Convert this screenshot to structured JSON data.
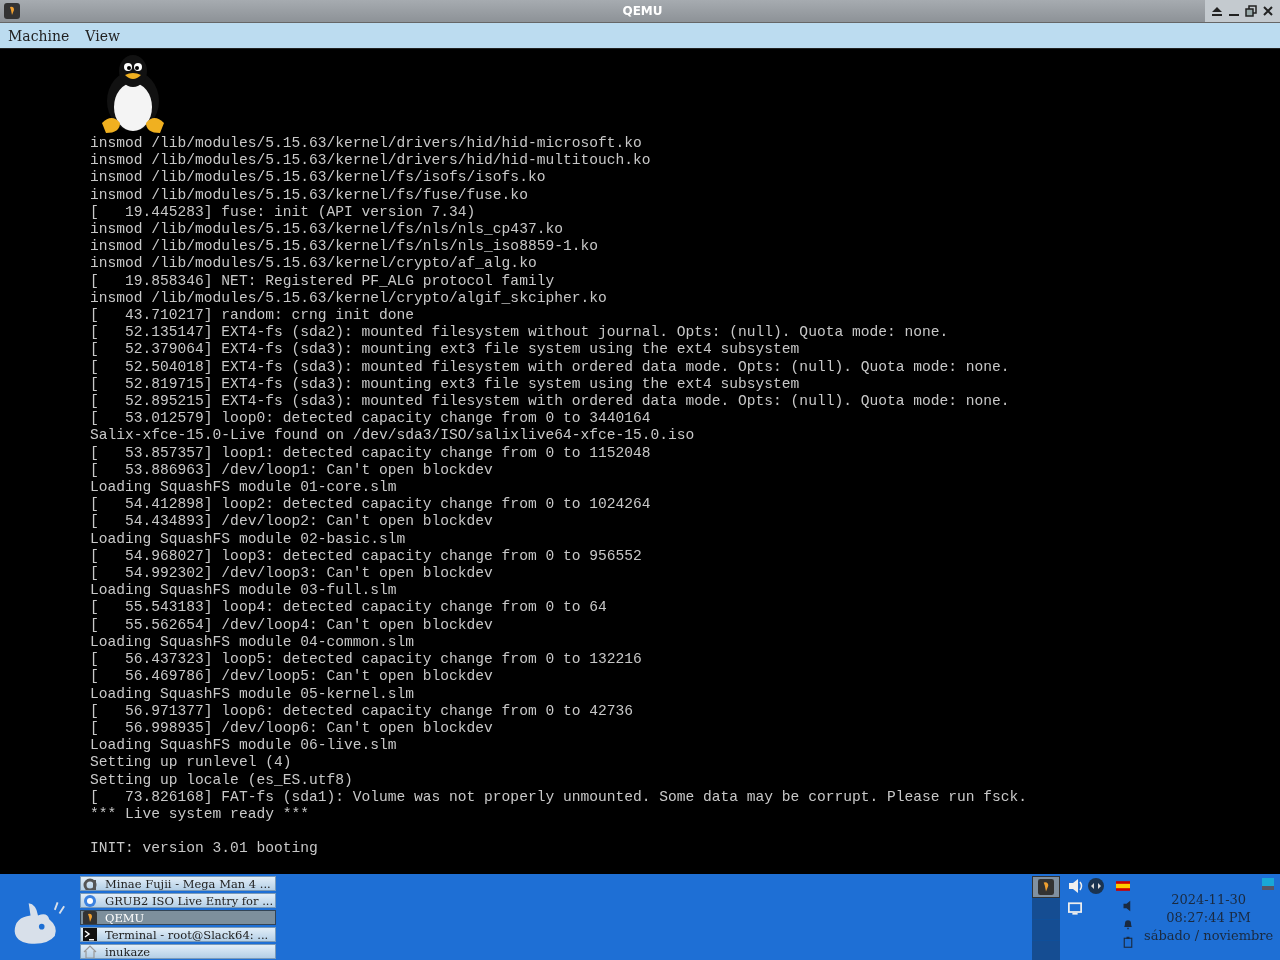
{
  "window": {
    "title": "QEMU"
  },
  "menu": [
    {
      "label": "Machine"
    },
    {
      "label": "View"
    }
  ],
  "console": {
    "lines": [
      "insmod /lib/modules/5.15.63/kernel/drivers/hid/hid-microsoft.ko",
      "insmod /lib/modules/5.15.63/kernel/drivers/hid/hid-multitouch.ko",
      "insmod /lib/modules/5.15.63/kernel/fs/isofs/isofs.ko",
      "insmod /lib/modules/5.15.63/kernel/fs/fuse/fuse.ko",
      "[   19.445283] fuse: init (API version 7.34)",
      "insmod /lib/modules/5.15.63/kernel/fs/nls/nls_cp437.ko",
      "insmod /lib/modules/5.15.63/kernel/fs/nls/nls_iso8859-1.ko",
      "insmod /lib/modules/5.15.63/kernel/crypto/af_alg.ko",
      "[   19.858346] NET: Registered PF_ALG protocol family",
      "insmod /lib/modules/5.15.63/kernel/crypto/algif_skcipher.ko",
      "[   43.710217] random: crng init done",
      "[   52.135147] EXT4-fs (sda2): mounted filesystem without journal. Opts: (null). Quota mode: none.",
      "[   52.379064] EXT4-fs (sda3): mounting ext3 file system using the ext4 subsystem",
      "[   52.504018] EXT4-fs (sda3): mounted filesystem with ordered data mode. Opts: (null). Quota mode: none.",
      "[   52.819715] EXT4-fs (sda3): mounting ext3 file system using the ext4 subsystem",
      "[   52.895215] EXT4-fs (sda3): mounted filesystem with ordered data mode. Opts: (null). Quota mode: none.",
      "[   53.012579] loop0: detected capacity change from 0 to 3440164",
      "Salix-xfce-15.0-Live found on /dev/sda3/ISO/salixlive64-xfce-15.0.iso",
      "[   53.857357] loop1: detected capacity change from 0 to 1152048",
      "[   53.886963] /dev/loop1: Can't open blockdev",
      "Loading SquashFS module 01-core.slm",
      "[   54.412898] loop2: detected capacity change from 0 to 1024264",
      "[   54.434893] /dev/loop2: Can't open blockdev",
      "Loading SquashFS module 02-basic.slm",
      "[   54.968027] loop3: detected capacity change from 0 to 956552",
      "[   54.992302] /dev/loop3: Can't open blockdev",
      "Loading SquashFS module 03-full.slm",
      "[   55.543183] loop4: detected capacity change from 0 to 64",
      "[   55.562654] /dev/loop4: Can't open blockdev",
      "Loading SquashFS module 04-common.slm",
      "[   56.437323] loop5: detected capacity change from 0 to 132216",
      "[   56.469786] /dev/loop5: Can't open blockdev",
      "Loading SquashFS module 05-kernel.slm",
      "[   56.971377] loop6: detected capacity change from 0 to 42736",
      "[   56.998935] /dev/loop6: Can't open blockdev",
      "Loading SquashFS module 06-live.slm",
      "Setting up runlevel (4)",
      "Setting up locale (es_ES.utf8)",
      "[   73.826168] FAT-fs (sda1): Volume was not properly unmounted. Some data may be corrupt. Please run fsck.",
      "*** Live system ready ***"
    ],
    "status_line": "INIT: version 3.01 booting"
  },
  "taskbar": {
    "windows": [
      {
        "kind": "music",
        "label": "Minae Fujii - Mega Man 4 ...",
        "selected": false
      },
      {
        "kind": "browser",
        "label": "GRUB2 ISO Live Entry for ...",
        "selected": false
      },
      {
        "kind": "qemu",
        "label": "QEMU",
        "selected": true
      },
      {
        "kind": "terminal",
        "label": "Terminal - root@Slack64: ...",
        "selected": false
      },
      {
        "kind": "home",
        "label": "inukaze",
        "selected": false
      }
    ],
    "workspaces": [
      {
        "selected": true
      },
      {
        "selected": false
      },
      {
        "selected": false
      },
      {
        "selected": false
      }
    ],
    "clock": {
      "date": "2024-11-30",
      "time": "08:27:44 PM",
      "day": "sábado / noviembre"
    }
  }
}
